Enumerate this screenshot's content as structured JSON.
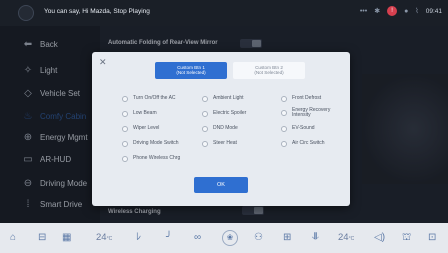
{
  "statusbar": {
    "voice_text": "You can say, Hi Mazda, Stop Playing",
    "clock": "09:41",
    "icons": [
      "dots-icon",
      "bluetooth-icon",
      "notification-icon",
      "user-icon",
      "signal-icon"
    ]
  },
  "sidebar": {
    "items": [
      {
        "label": "Back",
        "icon": "back-arrow-icon"
      },
      {
        "label": "Light",
        "icon": "light-icon"
      },
      {
        "label": "Vehicle Set",
        "icon": "vehicle-icon"
      },
      {
        "label": "Comfy Cabin",
        "icon": "cabin-icon",
        "selected": true
      },
      {
        "label": "Energy Mgmt",
        "icon": "energy-icon"
      },
      {
        "label": "AR-HUD",
        "icon": "hud-icon"
      },
      {
        "label": "Driving Mode",
        "icon": "steering-icon"
      },
      {
        "label": "Smart Drive",
        "icon": "smart-drive-icon"
      }
    ]
  },
  "main": {
    "top_setting": "Automatic Folding of Rear-View Mirror",
    "bottom_setting": "Wireless Charging"
  },
  "dialog": {
    "tab1": {
      "title": "Custom Btn 1",
      "sub": "(Not Selected)"
    },
    "tab2": {
      "title": "Custom Btn 2",
      "sub": "(Not Selected)"
    },
    "options": [
      "Turn On/Off the AC",
      "Ambient Light",
      "Front Defrost",
      "Low Beam",
      "Electric Spoiler",
      "Energy Recovery Intensity",
      "Wiper Level",
      "DND Mode",
      "EV-Sound",
      "Driving Mode Switch",
      "Steer Heat",
      "Air Circ Switch",
      "Phone Wireless Chrg"
    ],
    "ok_label": "OK"
  },
  "dock": {
    "left_temp": "24",
    "left_unit": "°C",
    "right_temp": "24",
    "right_unit": "°C"
  },
  "colors": {
    "accent": "#2f6fd1",
    "background": "#1c222c",
    "dialog": "#e7ebf1",
    "dock": "#e6e9ee"
  }
}
